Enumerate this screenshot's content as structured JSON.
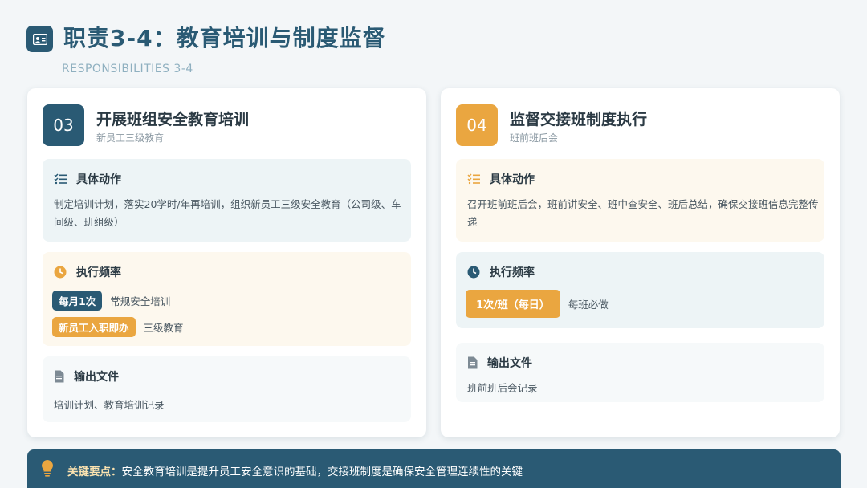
{
  "header": {
    "title": "职责3-4：教育培训与制度监督",
    "subtitle": "RESPONSIBILITIES 3-4",
    "icon": "id-card-icon"
  },
  "cards": [
    {
      "number": "03",
      "title": "开展班组安全教育培训",
      "subtitle": "新员工三级教育",
      "accent": "#2a5a74",
      "actions": {
        "heading": "具体动作",
        "icon": "checklist-icon",
        "text": "制定培训计划，落实20学时/年再培训，组织新员工三级安全教育（公司级、车间级、班组级）"
      },
      "frequency": {
        "heading": "执行频率",
        "icon": "clock-icon",
        "items": [
          {
            "tag": "每月1次",
            "note": "常规安全培训",
            "color": "#2a5a74"
          },
          {
            "tag": "新员工入职即办",
            "note": "三级教育",
            "color": "#eaa640"
          }
        ]
      },
      "output": {
        "heading": "输出文件",
        "icon": "document-icon",
        "text": "培训计划、教育培训记录"
      }
    },
    {
      "number": "04",
      "title": "监督交接班制度执行",
      "subtitle": "班前班后会",
      "accent": "#eaa640",
      "actions": {
        "heading": "具体动作",
        "icon": "checklist-icon",
        "text": "召开班前班后会，班前讲安全、班中查安全、班后总结，确保交接班信息完整传递"
      },
      "frequency": {
        "heading": "执行频率",
        "icon": "clock-icon",
        "items": [
          {
            "tag": "1次/班（每日）",
            "note": "每班必做",
            "color": "#eaa640"
          }
        ]
      },
      "output": {
        "heading": "输出文件",
        "icon": "document-icon",
        "text": "班前班后会记录"
      }
    }
  ],
  "footer": {
    "label": "关键要点：",
    "text": "安全教育培训是提升员工安全意识的基础，交接班制度是确保安全管理连续性的关键",
    "icon": "lightbulb-icon"
  }
}
